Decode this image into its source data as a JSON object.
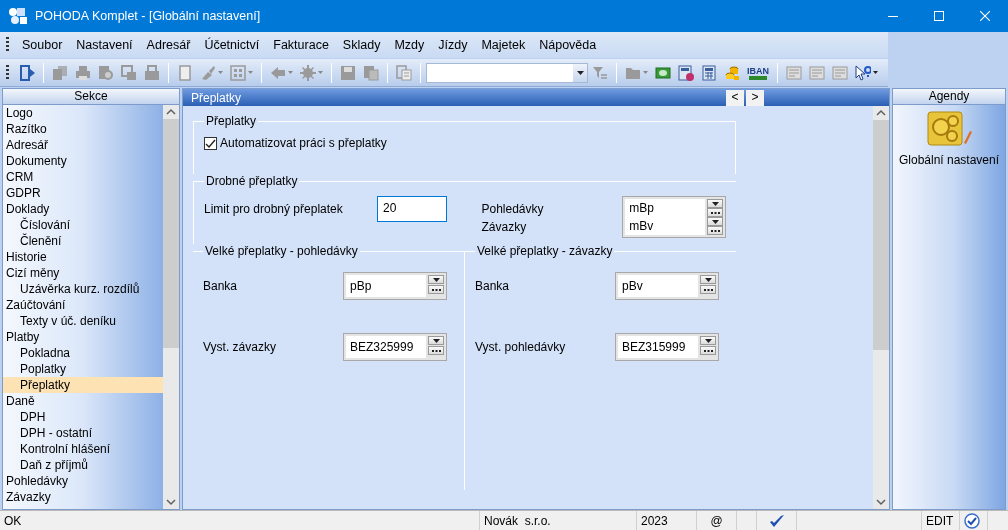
{
  "window": {
    "title": "POHODA Komplet - [Globální nastavení]"
  },
  "menu": [
    "Soubor",
    "Nastavení",
    "Adresář",
    "Účetnictví",
    "Fakturace",
    "Sklady",
    "Mzdy",
    "Jízdy",
    "Majetek",
    "Nápověda"
  ],
  "toolbar": [
    {
      "kind": "exit",
      "disabled": false,
      "dropdown": false
    },
    {
      "kind": "separator"
    },
    {
      "kind": "copy",
      "disabled": true,
      "dropdown": false
    },
    {
      "kind": "print",
      "disabled": true,
      "dropdown": false
    },
    {
      "kind": "preview",
      "disabled": true,
      "dropdown": false
    },
    {
      "kind": "export",
      "disabled": true,
      "dropdown": false
    },
    {
      "kind": "import",
      "disabled": true,
      "dropdown": false
    },
    {
      "kind": "separator"
    },
    {
      "kind": "new",
      "disabled": true,
      "dropdown": false
    },
    {
      "kind": "edit",
      "disabled": true,
      "dropdown": true
    },
    {
      "kind": "grid",
      "disabled": true,
      "dropdown": true
    },
    {
      "kind": "separator"
    },
    {
      "kind": "back",
      "disabled": true,
      "dropdown": true
    },
    {
      "kind": "gear",
      "disabled": true,
      "dropdown": true
    },
    {
      "kind": "separator"
    },
    {
      "kind": "save",
      "disabled": true,
      "dropdown": false
    },
    {
      "kind": "pages",
      "disabled": true,
      "dropdown": false
    },
    {
      "kind": "separator"
    },
    {
      "kind": "clipboard",
      "disabled": true,
      "dropdown": false
    },
    {
      "kind": "separator"
    },
    {
      "kind": "combo"
    },
    {
      "kind": "filter",
      "disabled": true,
      "dropdown": false
    },
    {
      "kind": "separator"
    },
    {
      "kind": "folder",
      "disabled": true,
      "dropdown": true
    },
    {
      "kind": "money",
      "disabled": false,
      "dropdown": false
    },
    {
      "kind": "calc-percent",
      "disabled": false,
      "dropdown": false
    },
    {
      "kind": "calculator",
      "disabled": false,
      "dropdown": false
    },
    {
      "kind": "coins",
      "disabled": false,
      "dropdown": false
    },
    {
      "kind": "iban",
      "disabled": false,
      "dropdown": false,
      "label": "IBAN"
    },
    {
      "kind": "separator"
    },
    {
      "kind": "card",
      "disabled": true,
      "dropdown": false
    },
    {
      "kind": "card",
      "disabled": true,
      "dropdown": false
    },
    {
      "kind": "card",
      "disabled": true,
      "dropdown": false
    },
    {
      "kind": "help",
      "disabled": false,
      "dropdown": true
    }
  ],
  "sections": {
    "header": "Sekce",
    "items": [
      {
        "label": "Logo",
        "selected": false
      },
      {
        "label": "Razítko",
        "selected": false
      },
      {
        "label": "Adresář",
        "selected": false
      },
      {
        "label": "Dokumenty",
        "selected": false
      },
      {
        "label": "CRM",
        "selected": false
      },
      {
        "label": "GDPR",
        "selected": false
      },
      {
        "label": "Doklady",
        "selected": false,
        "children": [
          {
            "label": "Číslování",
            "selected": false
          },
          {
            "label": "Členění",
            "selected": false
          }
        ]
      },
      {
        "label": "Historie",
        "selected": false
      },
      {
        "label": "Cizí měny",
        "selected": false,
        "children": [
          {
            "label": "Uzávěrka kurz. rozdílů",
            "selected": false
          }
        ]
      },
      {
        "label": "Zaúčtování",
        "selected": false,
        "children": [
          {
            "label": "Texty v úč. deníku",
            "selected": false
          }
        ]
      },
      {
        "label": "Platby",
        "selected": false,
        "children": [
          {
            "label": "Pokladna",
            "selected": false
          },
          {
            "label": "Poplatky",
            "selected": false
          },
          {
            "label": "Přeplatky",
            "selected": true
          }
        ]
      },
      {
        "label": "Daně",
        "selected": false,
        "children": [
          {
            "label": "DPH",
            "selected": false
          },
          {
            "label": "DPH - ostatní",
            "selected": false
          },
          {
            "label": "Kontrolní hlášení",
            "selected": false
          },
          {
            "label": "Daň z příjmů",
            "selected": false
          }
        ]
      },
      {
        "label": "Pohledávky",
        "selected": false
      },
      {
        "label": "Závazky",
        "selected": false
      }
    ]
  },
  "panel": {
    "title": "Přeplatky",
    "nav": [
      "<",
      ">"
    ],
    "overpayments": {
      "legend": "Přeplatky",
      "auto": {
        "label": "Automatizovat práci s přeplatky",
        "checked": true
      }
    },
    "small": {
      "legend": "Drobné přeplatky",
      "limit": {
        "label": "Limit pro drobný přeplatek",
        "value": "20",
        "focused": true
      },
      "codes": [
        {
          "label": "Pohledávky",
          "value": "mBp"
        },
        {
          "label": "Závazky",
          "value": "mBv"
        }
      ]
    },
    "large": [
      {
        "legend": "Velké přeplatky - pohledávky",
        "fields": [
          {
            "label": "Banka",
            "value": "pBp"
          },
          {
            "label": "Vyst. závazky",
            "value": "BEZ325999"
          }
        ]
      },
      {
        "legend": "Velké přeplatky - závazky",
        "fields": [
          {
            "label": "Banka",
            "value": "pBv"
          },
          {
            "label": "Vyst. pohledávky",
            "value": "BEZ315999"
          }
        ]
      }
    ]
  },
  "agendas": {
    "header": "Agendy",
    "items": [
      {
        "label": "Globální nastavení"
      }
    ]
  },
  "status_bar": {
    "message": "OK",
    "company": "Novák  s.r.o.",
    "year": "2023",
    "mail": "@",
    "mode": "EDIT"
  }
}
